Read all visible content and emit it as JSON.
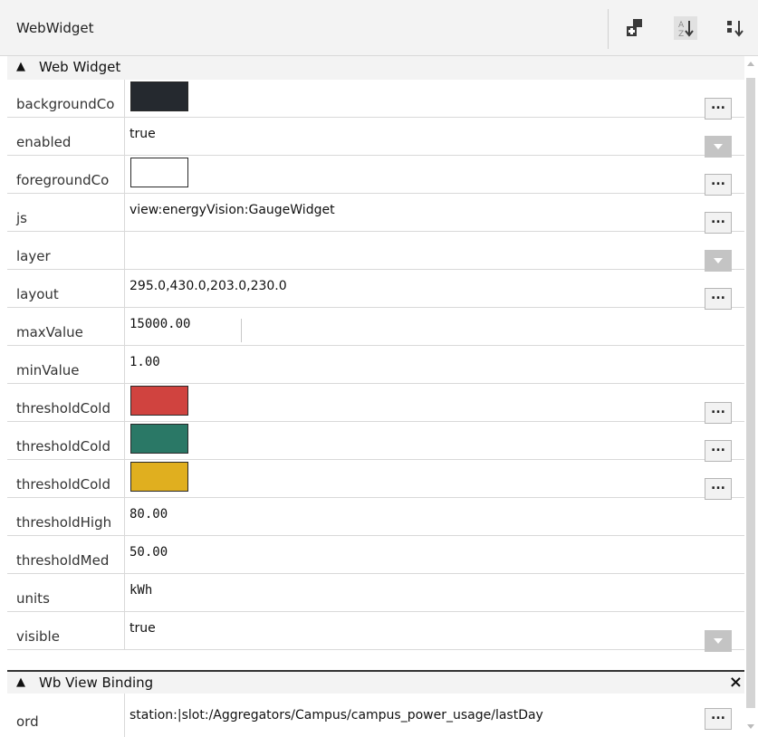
{
  "header": {
    "title": "WebWidget"
  },
  "toolbar": {
    "icons": [
      "new-slot-icon",
      "sort-alpha-icon",
      "sort-order-icon"
    ]
  },
  "section1": {
    "title": "Web Widget"
  },
  "rows": [
    {
      "name": "backgroundColor",
      "label": "backgroundCo",
      "kind": "color",
      "color": "#25292f",
      "button": "..."
    },
    {
      "name": "enabled",
      "label": "enabled",
      "kind": "text",
      "value": "true",
      "dropdown": true
    },
    {
      "name": "foregroundColor",
      "label": "foregroundCo",
      "kind": "color",
      "color": "#ffffff",
      "button": "..."
    },
    {
      "name": "js",
      "label": "js",
      "kind": "text",
      "value": "view:energyVision:GaugeWidget",
      "button": "..."
    },
    {
      "name": "layer",
      "label": "layer",
      "kind": "text",
      "value": "",
      "dropdown": true
    },
    {
      "name": "layout",
      "label": "layout",
      "kind": "text",
      "value": "295.0,430.0,203.0,230.0",
      "button": "..."
    },
    {
      "name": "maxValue",
      "label": "maxValue",
      "kind": "mono",
      "value": "15000.00"
    },
    {
      "name": "minValue",
      "label": "minValue",
      "kind": "mono",
      "value": "1.00"
    },
    {
      "name": "thresholdColorHigh",
      "label": "thresholdCold",
      "kind": "color",
      "color": "#d0433f",
      "button": "..."
    },
    {
      "name": "thresholdColorLow",
      "label": "thresholdCold",
      "kind": "color",
      "color": "#2a7866",
      "button": "..."
    },
    {
      "name": "thresholdColorMed",
      "label": "thresholdCold",
      "kind": "color",
      "color": "#e0af1f",
      "button": "..."
    },
    {
      "name": "thresholdHigh",
      "label": "thresholdHigh",
      "kind": "mono",
      "value": "80.00"
    },
    {
      "name": "thresholdMed",
      "label": "thresholdMed",
      "kind": "mono",
      "value": "50.00"
    },
    {
      "name": "units",
      "label": "units",
      "kind": "mono",
      "value": "kWh"
    },
    {
      "name": "visible",
      "label": "visible",
      "kind": "text",
      "value": "true",
      "dropdown": true
    }
  ],
  "section2": {
    "title": "Wb View Binding",
    "close": "×"
  },
  "binding": {
    "label": "ord",
    "value": "station:|slot:/Aggregators/Campus/campus_power_usage/lastDay",
    "button": "..."
  },
  "section_arrow": "▲"
}
